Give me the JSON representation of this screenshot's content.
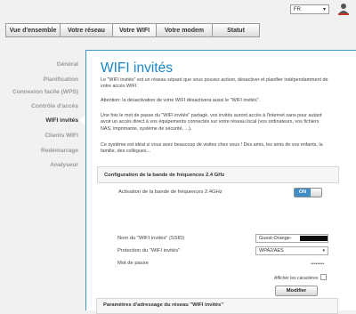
{
  "header": {
    "language": "FR",
    "user_icon": "user-icon"
  },
  "tabs": [
    {
      "label": "Vue d'ensemble",
      "active": false
    },
    {
      "label": "Votre réseau",
      "active": false
    },
    {
      "label": "Votre WIFI",
      "active": true
    },
    {
      "label": "Votre modem",
      "active": false
    },
    {
      "label": "Statut",
      "active": false
    }
  ],
  "sidebar": {
    "items": [
      {
        "label": "Général"
      },
      {
        "label": "Planification"
      },
      {
        "label": "Connexion facile (WPS)"
      },
      {
        "label": "Contrôle d'accès"
      },
      {
        "label": "WIFI invités",
        "active": true
      },
      {
        "label": "Clients WIFI"
      },
      {
        "label": "Redémarrage"
      },
      {
        "label": "Analyseur"
      }
    ]
  },
  "main": {
    "title": "WIFI invités",
    "intro": "Le \"WIFI invités\" est un réseau séparé que vous pouvez activer, désactiver et planifier indépendamment de votre accès WIFI.",
    "attention": "Attention: la désactivation de votre WIFI désactivera aussi le \"WIFI invités\".",
    "share_info": "Une fois le mot de passe du \"WIFI invités\" partagé, vos invités auront accès à l'internet sans pour autant avoir un accès direct à vos équipements connectés sur votre réseau local (vos ordinateurs, vos fichiers NAS, imprimante, système de sécurité, ...).",
    "ideal": "Ce système est idéal si vous avez beaucoup de visites chez vous ! Des amis, les amis de vos enfants, la famille, des collègues...",
    "band_section": {
      "title": "Configuration de la bande de fréquences 2.4 GHz",
      "activation_label": "Activation de la bande de fréquences 2.4GHz",
      "toggle_label": "ON",
      "toggle_on": true
    },
    "ssid_label": "Nom du \"WIFI invités\" (SSID)",
    "ssid_value": "Guest-Orange-",
    "protection_label": "Protection du \"WIFI invités\"",
    "protection_value": "WPA2/AES",
    "password_label": "Mot de passe",
    "password_value": "••••••••",
    "show_chars_label": "Afficher les caractères",
    "modify_button": "Modifier",
    "addressing_section": {
      "title": "Paramètres d'adressage du réseau \"WIFI invités\""
    }
  },
  "colors": {
    "accent": "#1a86c8",
    "panel_border": "#3f97c9",
    "toggle_on": "#3f8dc6",
    "background": "#f1f1f1"
  }
}
